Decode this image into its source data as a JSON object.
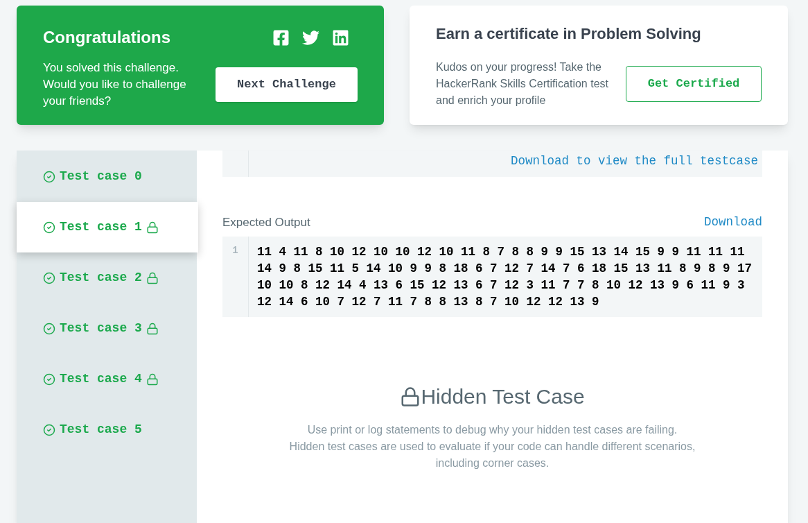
{
  "success_card": {
    "title": "Congratulations",
    "message": "You solved this challenge. Would you like to challenge your friends?",
    "button": "Next Challenge"
  },
  "certificate_card": {
    "title": "Earn a certificate in Problem Solving",
    "message": "Kudos on your progress! Take the HackerRank Skills Certification test and enrich your profile",
    "button": "Get Certified"
  },
  "test_cases": [
    {
      "label": "Test case 0",
      "passed": true,
      "locked": false,
      "selected": false
    },
    {
      "label": "Test case 1",
      "passed": true,
      "locked": true,
      "selected": true
    },
    {
      "label": "Test case 2",
      "passed": true,
      "locked": true,
      "selected": false
    },
    {
      "label": "Test case 3",
      "passed": true,
      "locked": true,
      "selected": false
    },
    {
      "label": "Test case 4",
      "passed": true,
      "locked": true,
      "selected": false
    },
    {
      "label": "Test case 5",
      "passed": true,
      "locked": false,
      "selected": false
    }
  ],
  "input_block": {
    "link": "Download to view the full testcase"
  },
  "expected_output": {
    "label": "Expected Output",
    "download": "Download",
    "lines": [
      {
        "number": "1",
        "text": "11 4 11 8 10 12 10 10 12 10 11 8 7 8 8 9 9 15 13 14 15 9 9 11 11 11 14 9 8 15 11 5 14 10 9 9 8 18 6 7 12 7 14 7 6 18 15 13 11 8 9 8 9 17 10 10 8 12 14 4 13 6 15 12 13 6 7 12 3 11 7 7 8 10 12 13 9 6 11 9 3 12 14 6 10 7 12 7 11 7 8 8 13 8 7 10 12 12 13 9"
      }
    ]
  },
  "hidden_notice": {
    "title": "Hidden Test Case",
    "paragraphs": [
      "Use print or log statements to debug why your hidden test cases are failing.",
      "Hidden test cases are used to evaluate if your code can handle different scenarios, including corner cases."
    ]
  }
}
